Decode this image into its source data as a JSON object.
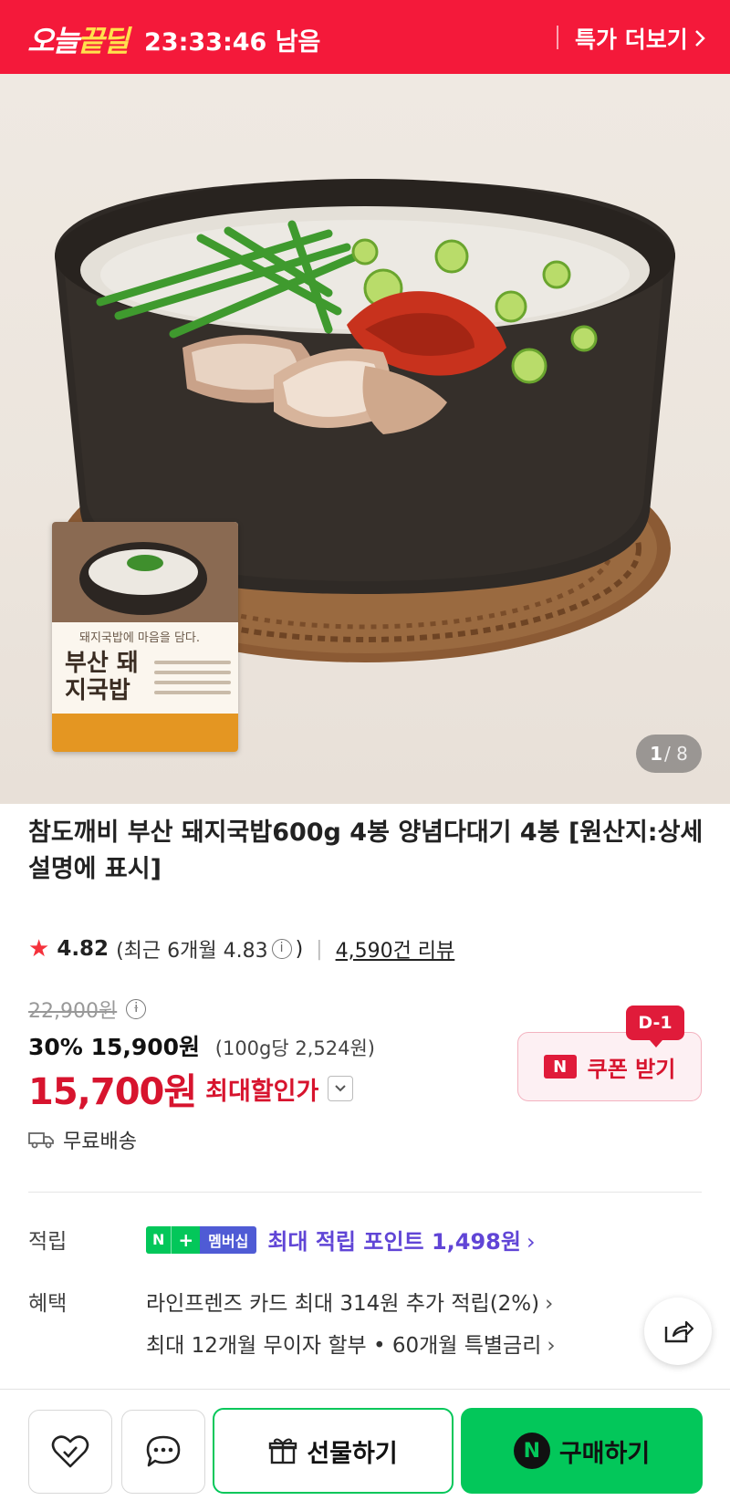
{
  "deal_banner": {
    "logo_part1": "오늘",
    "logo_part2": "끝딜",
    "timer": "23:33:46 남음",
    "more_label": "특가 더보기",
    "chevron_icon": "chevron-right-icon"
  },
  "gallery": {
    "counter_current": "1",
    "counter_total": "/ 8",
    "package_subtitle": "돼지국밥에 마음을 담다.",
    "package_title": "부산 돼지국밥"
  },
  "product": {
    "title": "참도깨비 부산 돼지국밥600g 4봉 양념다대기 4봉 [원산지:상세설명에 표시]",
    "rating": "4.82",
    "recent_rating": "(최근 6개월 4.83",
    "recent_rating_close": ")",
    "review_count": "4,590건 리뷰",
    "original_price": "22,900원",
    "discount_rate": "30%",
    "sale_price": "15,900원",
    "unit_price": "(100g당 2,524원)",
    "max_discount_price": "15,700원",
    "max_discount_label": "최대할인가",
    "shipping": "무료배송"
  },
  "coupon": {
    "badge": "D-1",
    "n_mark": "N",
    "label": "쿠폰 받기"
  },
  "points": {
    "label": "적립",
    "badge_n": "N",
    "badge_plus": "+",
    "badge_member": "멤버십",
    "text": "최대 적립 포인트 1,498원"
  },
  "benefits": {
    "label": "혜택",
    "line1": "라인프렌즈 카드 최대 314원 추가 적립(2%)",
    "line2": "최대 12개월 무이자 할부 • 60개월 특별금리"
  },
  "bottom_bar": {
    "gift_label": "선물하기",
    "buy_n": "N",
    "buy_label": "구매하기"
  },
  "colors": {
    "deal_red": "#f4193a",
    "price_red": "#d7142e",
    "naver_green": "#03c75a",
    "points_purple": "#6045d6"
  }
}
